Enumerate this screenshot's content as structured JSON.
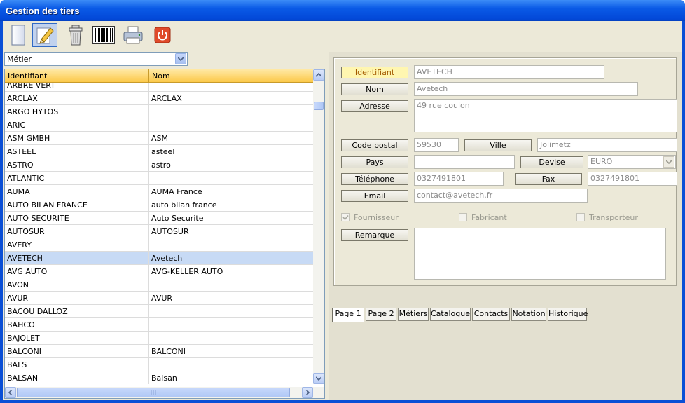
{
  "window": {
    "title": "Gestion des tiers"
  },
  "toolbar": {
    "icons": [
      "new-document-icon",
      "edit-icon",
      "delete-icon",
      "barcode-icon",
      "print-icon",
      "power-icon"
    ]
  },
  "filter": {
    "selected": "Métier"
  },
  "grid": {
    "columns": [
      "Identifiant",
      "Nom"
    ],
    "rows": [
      [
        "ARBRE VERT",
        ""
      ],
      [
        "ARCLAX",
        "ARCLAX"
      ],
      [
        "ARGO HYTOS",
        ""
      ],
      [
        "ARIC",
        ""
      ],
      [
        "ASM GMBH",
        "ASM"
      ],
      [
        "ASTEEL",
        "asteel"
      ],
      [
        "ASTRO",
        "astro"
      ],
      [
        "ATLANTIC",
        ""
      ],
      [
        "AUMA",
        "AUMA France"
      ],
      [
        "AUTO BILAN FRANCE",
        "auto bilan france"
      ],
      [
        "AUTO SECURITE",
        "Auto Securite"
      ],
      [
        "AUTOSUR",
        "AUTOSUR"
      ],
      [
        "AVERY",
        ""
      ],
      [
        "AVETECH",
        "Avetech"
      ],
      [
        "AVG AUTO",
        "AVG-KELLER AUTO"
      ],
      [
        "AVON",
        ""
      ],
      [
        "AVUR",
        "AVUR"
      ],
      [
        "BACOU DALLOZ",
        ""
      ],
      [
        "BAHCO",
        ""
      ],
      [
        "BAJOLET",
        ""
      ],
      [
        "BALCONI",
        "BALCONI"
      ],
      [
        "BALS",
        ""
      ],
      [
        "BALSAN",
        "Balsan"
      ]
    ],
    "selected_index": 13
  },
  "form": {
    "labels": {
      "identifiant": "Identifiant",
      "nom": "Nom",
      "adresse": "Adresse",
      "code_postal": "Code postal",
      "ville": "Ville",
      "pays": "Pays",
      "devise": "Devise",
      "telephone": "Téléphone",
      "fax": "Fax",
      "email": "Email",
      "remarque": "Remarque"
    },
    "values": {
      "identifiant": "AVETECH",
      "nom": "Avetech",
      "adresse": "49 rue coulon",
      "code_postal": "59530",
      "ville": "Jolimetz",
      "pays": "",
      "devise": "EURO",
      "telephone": "0327491801",
      "fax": "0327491801",
      "email": "contact@avetech.fr",
      "remarque": ""
    },
    "checkboxes": [
      {
        "label": "Fournisseur",
        "checked": true
      },
      {
        "label": "Fabricant",
        "checked": false
      },
      {
        "label": "Transporteur",
        "checked": false
      }
    ]
  },
  "tabs": [
    "Page 1",
    "Page 2",
    "Métiers",
    "Catalogue",
    "Contacts",
    "Notation",
    "Historique"
  ],
  "active_tab": 0
}
